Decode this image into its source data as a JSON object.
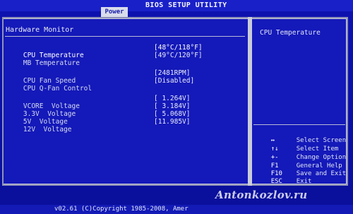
{
  "title": "BIOS SETUP UTILITY",
  "menu": {
    "active_tab": "Power"
  },
  "section": {
    "title": "Hardware Monitor"
  },
  "rows": [
    {
      "label": "CPU Temperature",
      "value": "[48°C/118°F]"
    },
    {
      "label": "MB Temperature",
      "value": "[49°C/120°F]"
    },
    {
      "label": "CPU Fan Speed",
      "value": "[2481RPM]"
    },
    {
      "label": "CPU Q-Fan Control",
      "value": "[Disabled]"
    },
    {
      "label": "VCORE  Voltage",
      "value": "[ 1.264V]"
    },
    {
      "label": "3.3V  Voltage",
      "value": "[ 3.184V]"
    },
    {
      "label": "5V  Voltage",
      "value": "[ 5.068V]"
    },
    {
      "label": "12V  Voltage",
      "value": "[11.985V]"
    }
  ],
  "help": {
    "title": "CPU Temperature"
  },
  "keys": [
    {
      "key": "↔",
      "desc": "Select Screen"
    },
    {
      "key": "↑↓",
      "desc": "Select Item"
    },
    {
      "key": "+-",
      "desc": "Change Option"
    },
    {
      "key": "F1",
      "desc": "General Help"
    },
    {
      "key": "F10",
      "desc": "Save and Exit"
    },
    {
      "key": "ESC",
      "desc": "Exit"
    }
  ],
  "footer": {
    "text": "v02.61 (C)Copyright 1985-2008, Amer"
  },
  "watermark": "Antonkozlov.ru"
}
